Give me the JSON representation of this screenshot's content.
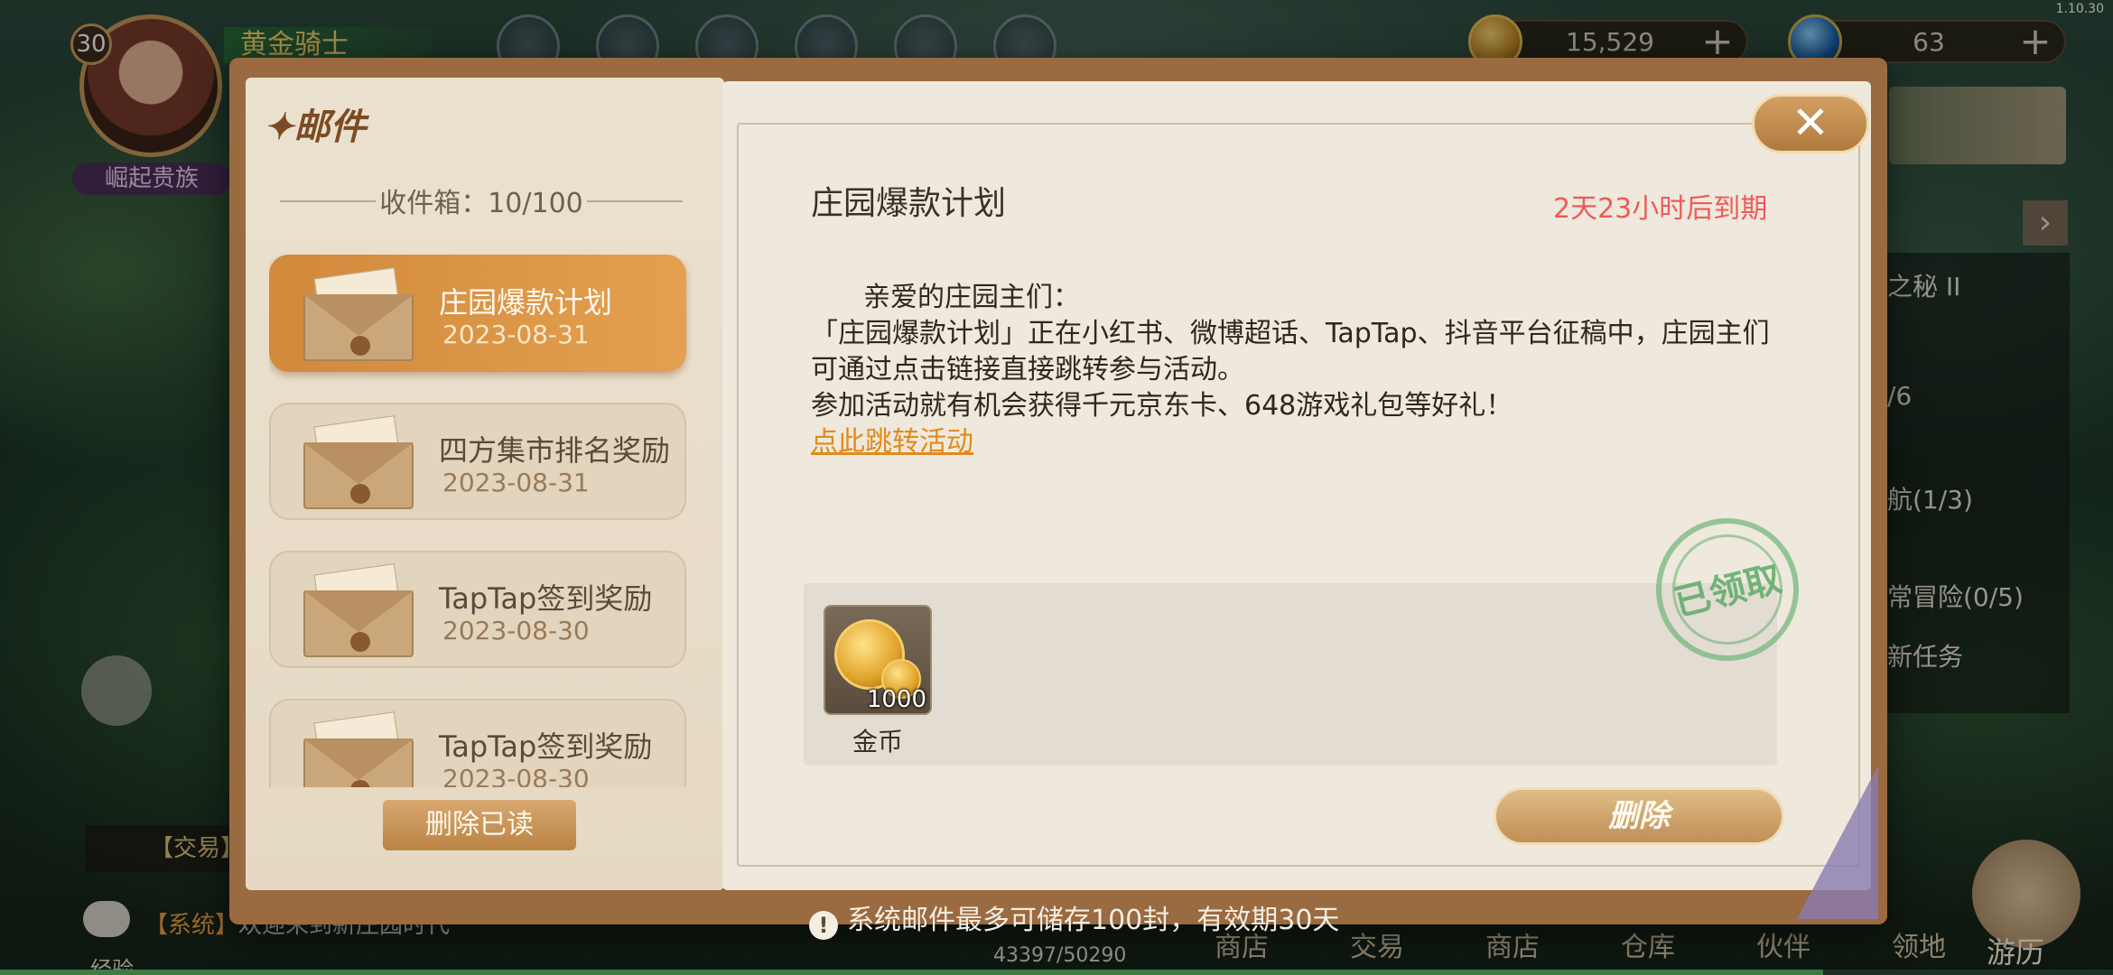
{
  "version": "1.10.30",
  "hud": {
    "level": "30",
    "title": "黄金骑士",
    "rank": "崛起贵族",
    "gold": "15,529",
    "gems": "63",
    "plus": "+",
    "quest_lines": [
      "之秘 II",
      "/6",
      "航(1/3)",
      "常冒险(0/5)",
      "新任务"
    ],
    "trade_tag": "【交易】",
    "chat_system": "【系统】",
    "chat_text": "欢迎来到新庄园时代",
    "xp_label": "经验",
    "xp_value": "43397/50290",
    "xp_fraction": 0.863,
    "bottom_nav": [
      "商店",
      "交易",
      "商店",
      "仓库",
      "伙伴",
      "领地"
    ],
    "travel": "游历"
  },
  "mail": {
    "heading": "邮件",
    "inbox_count": "收件箱：10/100",
    "items": [
      {
        "title": "庄园爆款计划",
        "date": "2023-08-31"
      },
      {
        "title": "四方集市排名奖励",
        "date": "2023-08-31"
      },
      {
        "title": "TapTap签到奖励",
        "date": "2023-08-30"
      },
      {
        "title": "TapTap签到奖励",
        "date": "2023-08-30"
      }
    ],
    "delete_read": "删除已读",
    "close_icon": "✕",
    "selected": {
      "title": "庄园爆款计划",
      "expire": "2天23小时后到期",
      "greeting": "亲爱的庄园主们：",
      "line1": "「庄园爆款计划」正在小红书、微博超话、TapTap、抖音平台征稿中，庄园主们可通过点击链接直接跳转参与活动。",
      "line2": "参加活动就有机会获得千元京东卡、648游戏礼包等好礼！",
      "link": "点此跳转活动",
      "stamp": "已领取",
      "reward_qty": "1000",
      "reward_name": "金币"
    },
    "delete": "删除",
    "footer": "系统邮件最多可储存100封，有效期30天",
    "footer_icon": "!"
  },
  "colors": {
    "expire": "#ef5a5a",
    "link": "#e18a1a",
    "selected_item": "#d1893c",
    "stamp": "#5aaa69"
  }
}
